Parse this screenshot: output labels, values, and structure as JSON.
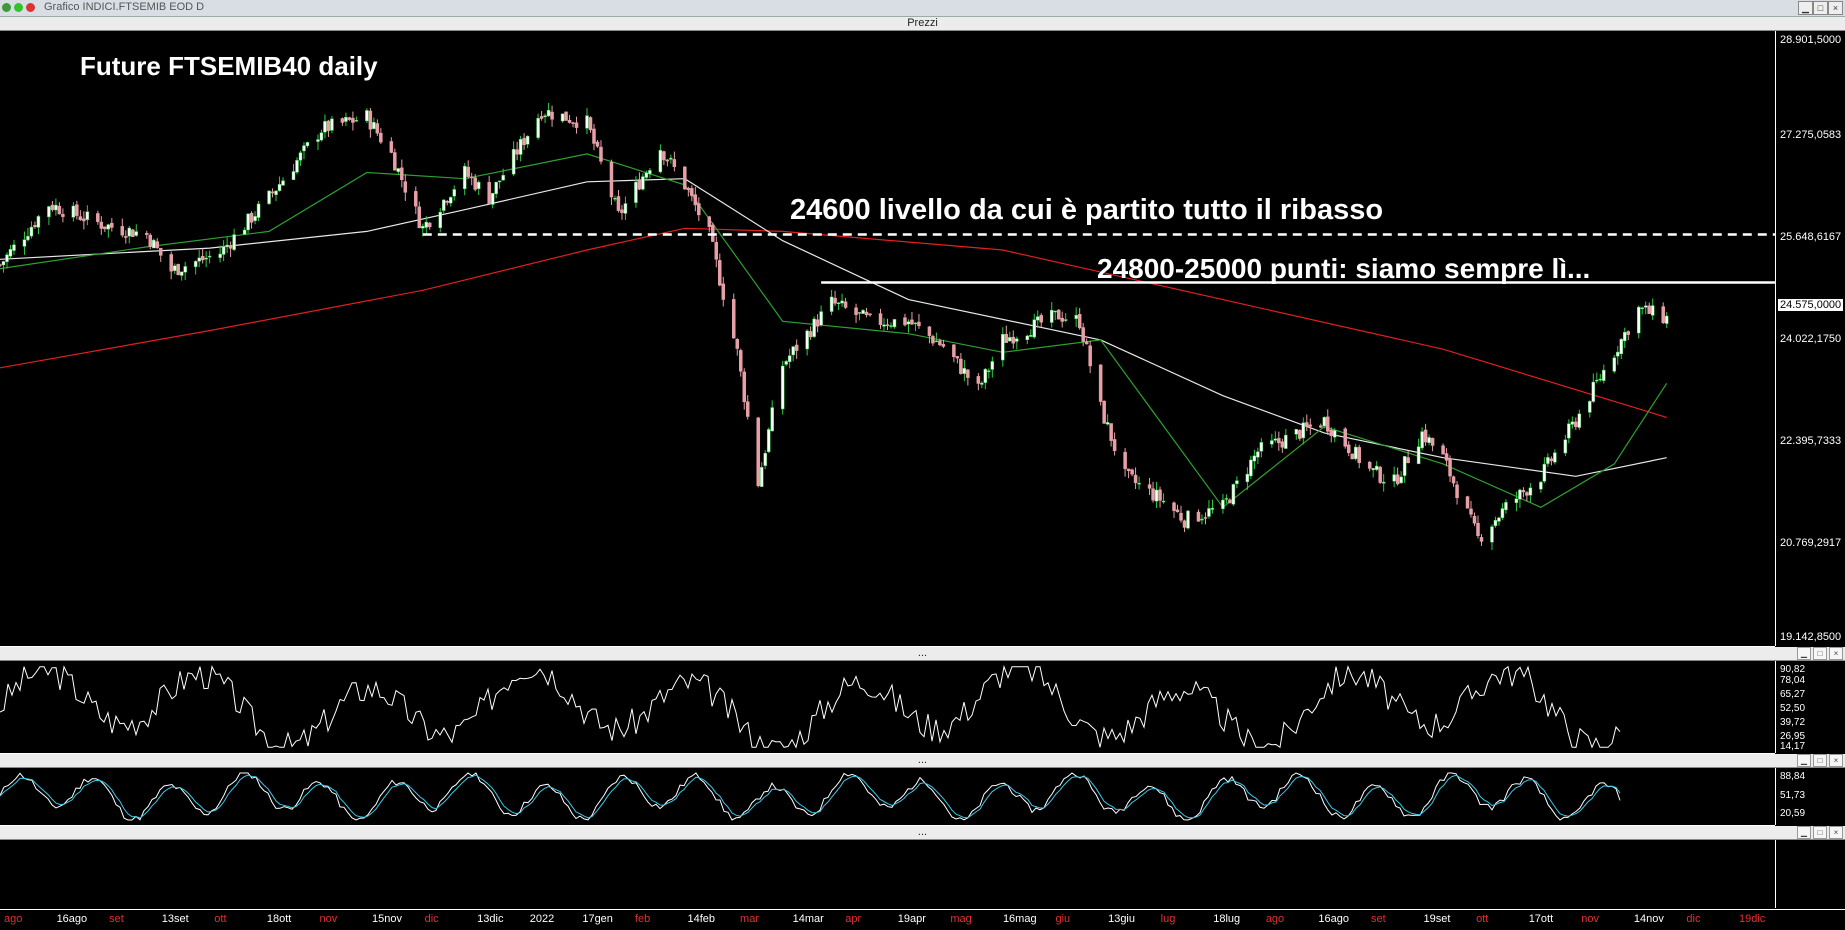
{
  "window": {
    "title": "Grafico INDICI.FTSEMIB EOD D",
    "dot_colors": [
      "#3a9a3a",
      "#2ec42e",
      "#d33"
    ]
  },
  "price_pane": {
    "header": "Prezzi",
    "y_labels": [
      "28.901,5000",
      "27.275,0583",
      "25.648,6167",
      "24.575,0000",
      "24.022,1750",
      "22.395,7333",
      "20.769,2917",
      "19.142,8500"
    ],
    "title": "Future FTSEMIB40 daily",
    "annotation_1": "24600  livello da cui è partito tutto il ribasso",
    "annotation_2": "24800-25000 punti: siamo sempre lì...",
    "header_controls": [
      "▁",
      "□",
      "×"
    ]
  },
  "rsi_pane": {
    "header": "...",
    "y_labels": [
      "90,82",
      "78,04",
      "65,27",
      "52,50",
      "39,72",
      "26,95",
      "14,17"
    ]
  },
  "stoch_pane": {
    "header": "...",
    "y_labels": [
      "88,84",
      "51,73",
      "20,59"
    ]
  },
  "empty_pane": {
    "header": "..."
  },
  "x_axis": [
    {
      "label": "ago",
      "color": "#e03030"
    },
    {
      "label": "16ago",
      "color": "#fff"
    },
    {
      "label": "set",
      "color": "#e03030"
    },
    {
      "label": "13set",
      "color": "#fff"
    },
    {
      "label": "ott",
      "color": "#e03030"
    },
    {
      "label": "18ott",
      "color": "#fff"
    },
    {
      "label": "nov",
      "color": "#e03030"
    },
    {
      "label": "15nov",
      "color": "#fff"
    },
    {
      "label": "dic",
      "color": "#e03030"
    },
    {
      "label": "13dic",
      "color": "#fff"
    },
    {
      "label": "2022",
      "color": "#fff"
    },
    {
      "label": "17gen",
      "color": "#fff"
    },
    {
      "label": "feb",
      "color": "#e03030"
    },
    {
      "label": "14feb",
      "color": "#fff"
    },
    {
      "label": "mar",
      "color": "#e03030"
    },
    {
      "label": "14mar",
      "color": "#fff"
    },
    {
      "label": "apr",
      "color": "#e03030"
    },
    {
      "label": "19apr",
      "color": "#fff"
    },
    {
      "label": "mag",
      "color": "#e03030"
    },
    {
      "label": "16mag",
      "color": "#fff"
    },
    {
      "label": "giu",
      "color": "#e03030"
    },
    {
      "label": "13giu",
      "color": "#fff"
    },
    {
      "label": "lug",
      "color": "#e03030"
    },
    {
      "label": "18lug",
      "color": "#fff"
    },
    {
      "label": "ago",
      "color": "#e03030"
    },
    {
      "label": "16ago",
      "color": "#fff"
    },
    {
      "label": "set",
      "color": "#e03030"
    },
    {
      "label": "19set",
      "color": "#fff"
    },
    {
      "label": "ott",
      "color": "#e03030"
    },
    {
      "label": "17ott",
      "color": "#fff"
    },
    {
      "label": "nov",
      "color": "#e03030"
    },
    {
      "label": "14nov",
      "color": "#fff"
    },
    {
      "label": "dic",
      "color": "#e03030"
    },
    {
      "label": "19dic",
      "color": "#e03030"
    }
  ],
  "chart_data": [
    {
      "type": "candlestick",
      "title": "Future FTSEMIB40 daily",
      "ylim": [
        19142.85,
        28901.5
      ],
      "x_start": "2021-08-02",
      "x_end": "2022-12-23",
      "series": [
        {
          "name": "price_close",
          "color": "#ffffff",
          "values": [
            [
              "2021-08-02",
              25210
            ],
            [
              "2021-08-16",
              26190
            ],
            [
              "2021-09-01",
              25850
            ],
            [
              "2021-09-13",
              25700
            ],
            [
              "2021-09-20",
              25120
            ],
            [
              "2021-10-04",
              25400
            ],
            [
              "2021-10-18",
              26300
            ],
            [
              "2021-11-02",
              27400
            ],
            [
              "2021-11-15",
              27600
            ],
            [
              "2021-11-22",
              27000
            ],
            [
              "2021-12-01",
              25800
            ],
            [
              "2021-12-13",
              26700
            ],
            [
              "2021-12-20",
              26300
            ],
            [
              "2022-01-04",
              27700
            ],
            [
              "2022-01-17",
              27500
            ],
            [
              "2022-01-26",
              26000
            ],
            [
              "2022-02-07",
              27100
            ],
            [
              "2022-02-14",
              26500
            ],
            [
              "2022-02-21",
              25700
            ],
            [
              "2022-03-01",
              23800
            ],
            [
              "2022-03-07",
              21700
            ],
            [
              "2022-03-14",
              23600
            ],
            [
              "2022-03-28",
              24600
            ],
            [
              "2022-04-08",
              24300
            ],
            [
              "2022-04-19",
              24300
            ],
            [
              "2022-04-29",
              23900
            ],
            [
              "2022-05-09",
              23200
            ],
            [
              "2022-05-16",
              24000
            ],
            [
              "2022-06-01",
              24400
            ],
            [
              "2022-06-07",
              24300
            ],
            [
              "2022-06-13",
              22900
            ],
            [
              "2022-06-20",
              21800
            ],
            [
              "2022-07-01",
              21400
            ],
            [
              "2022-07-07",
              21100
            ],
            [
              "2022-07-18",
              21300
            ],
            [
              "2022-07-28",
              22200
            ],
            [
              "2022-08-05",
              22400
            ],
            [
              "2022-08-16",
              22700
            ],
            [
              "2022-08-29",
              21900
            ],
            [
              "2022-09-05",
              21700
            ],
            [
              "2022-09-13",
              22500
            ],
            [
              "2022-09-19",
              22100
            ],
            [
              "2022-09-29",
              20800
            ],
            [
              "2022-10-07",
              21300
            ],
            [
              "2022-10-17",
              21800
            ],
            [
              "2022-10-27",
              22700
            ],
            [
              "2022-11-07",
              23800
            ],
            [
              "2022-11-14",
              24500
            ],
            [
              "2022-11-22",
              24350
            ]
          ]
        },
        {
          "name": "ma_long",
          "color": "#e02020",
          "values": [
            [
              "2021-08-02",
              23550
            ],
            [
              "2021-10-01",
              24150
            ],
            [
              "2021-12-01",
              24800
            ],
            [
              "2022-01-17",
              25450
            ],
            [
              "2022-02-14",
              25800
            ],
            [
              "2022-03-14",
              25750
            ],
            [
              "2022-05-16",
              25450
            ],
            [
              "2022-07-18",
              24650
            ],
            [
              "2022-09-19",
              23850
            ],
            [
              "2022-11-22",
              22750
            ]
          ]
        },
        {
          "name": "ma_mid",
          "color": "#e8e8e8",
          "values": [
            [
              "2021-08-02",
              25300
            ],
            [
              "2021-10-01",
              25480
            ],
            [
              "2021-11-15",
              25750
            ],
            [
              "2021-12-13",
              26100
            ],
            [
              "2022-01-17",
              26550
            ],
            [
              "2022-02-14",
              26600
            ],
            [
              "2022-03-14",
              25600
            ],
            [
              "2022-04-19",
              24650
            ],
            [
              "2022-06-13",
              24000
            ],
            [
              "2022-07-18",
              23100
            ],
            [
              "2022-08-16",
              22500
            ],
            [
              "2022-09-19",
              22100
            ],
            [
              "2022-10-27",
              21800
            ],
            [
              "2022-11-22",
              22100
            ]
          ]
        },
        {
          "name": "ma_short",
          "color": "#2ea02e",
          "values": [
            [
              "2021-08-02",
              25150
            ],
            [
              "2021-09-13",
              25500
            ],
            [
              "2021-10-18",
              25750
            ],
            [
              "2021-11-15",
              26700
            ],
            [
              "2021-12-13",
              26600
            ],
            [
              "2022-01-17",
              27000
            ],
            [
              "2022-02-14",
              26500
            ],
            [
              "2022-03-14",
              24300
            ],
            [
              "2022-04-19",
              24100
            ],
            [
              "2022-05-16",
              23800
            ],
            [
              "2022-06-13",
              24000
            ],
            [
              "2022-07-18",
              21300
            ],
            [
              "2022-08-16",
              22600
            ],
            [
              "2022-09-19",
              22000
            ],
            [
              "2022-10-17",
              21300
            ],
            [
              "2022-11-07",
              22000
            ],
            [
              "2022-11-22",
              23300
            ]
          ]
        }
      ],
      "lines": [
        {
          "label": "24600  livello da cui è partito tutto il ribasso",
          "style": "dashed",
          "y_price": 25700,
          "x_from": "2021-12-01",
          "x_to": "2022-12-23"
        },
        {
          "label": "24800-25000 punti: siamo sempre lì...",
          "style": "solid",
          "y_price": 24925,
          "x_from": "2022-03-25",
          "x_to": "2022-12-23"
        }
      ]
    },
    {
      "type": "line",
      "name": "rsi",
      "ylim": [
        14.17,
        90.82
      ],
      "y_ticks": [
        90.82,
        78.04,
        65.27,
        52.5,
        39.72,
        26.95,
        14.17
      ]
    },
    {
      "type": "line",
      "name": "stochastic",
      "ylim": [
        20.59,
        88.84
      ],
      "y_ticks": [
        88.84,
        51.73,
        20.59
      ]
    }
  ]
}
